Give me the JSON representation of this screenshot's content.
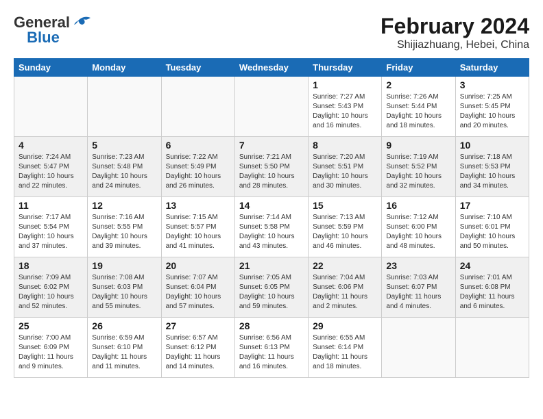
{
  "header": {
    "logo_general": "General",
    "logo_blue": "Blue",
    "month_year": "February 2024",
    "location": "Shijiazhuang, Hebei, China"
  },
  "days_of_week": [
    "Sunday",
    "Monday",
    "Tuesday",
    "Wednesday",
    "Thursday",
    "Friday",
    "Saturday"
  ],
  "weeks": [
    [
      {
        "day": "",
        "info": ""
      },
      {
        "day": "",
        "info": ""
      },
      {
        "day": "",
        "info": ""
      },
      {
        "day": "",
        "info": ""
      },
      {
        "day": "1",
        "info": "Sunrise: 7:27 AM\nSunset: 5:43 PM\nDaylight: 10 hours\nand 16 minutes."
      },
      {
        "day": "2",
        "info": "Sunrise: 7:26 AM\nSunset: 5:44 PM\nDaylight: 10 hours\nand 18 minutes."
      },
      {
        "day": "3",
        "info": "Sunrise: 7:25 AM\nSunset: 5:45 PM\nDaylight: 10 hours\nand 20 minutes."
      }
    ],
    [
      {
        "day": "4",
        "info": "Sunrise: 7:24 AM\nSunset: 5:47 PM\nDaylight: 10 hours\nand 22 minutes."
      },
      {
        "day": "5",
        "info": "Sunrise: 7:23 AM\nSunset: 5:48 PM\nDaylight: 10 hours\nand 24 minutes."
      },
      {
        "day": "6",
        "info": "Sunrise: 7:22 AM\nSunset: 5:49 PM\nDaylight: 10 hours\nand 26 minutes."
      },
      {
        "day": "7",
        "info": "Sunrise: 7:21 AM\nSunset: 5:50 PM\nDaylight: 10 hours\nand 28 minutes."
      },
      {
        "day": "8",
        "info": "Sunrise: 7:20 AM\nSunset: 5:51 PM\nDaylight: 10 hours\nand 30 minutes."
      },
      {
        "day": "9",
        "info": "Sunrise: 7:19 AM\nSunset: 5:52 PM\nDaylight: 10 hours\nand 32 minutes."
      },
      {
        "day": "10",
        "info": "Sunrise: 7:18 AM\nSunset: 5:53 PM\nDaylight: 10 hours\nand 34 minutes."
      }
    ],
    [
      {
        "day": "11",
        "info": "Sunrise: 7:17 AM\nSunset: 5:54 PM\nDaylight: 10 hours\nand 37 minutes."
      },
      {
        "day": "12",
        "info": "Sunrise: 7:16 AM\nSunset: 5:55 PM\nDaylight: 10 hours\nand 39 minutes."
      },
      {
        "day": "13",
        "info": "Sunrise: 7:15 AM\nSunset: 5:57 PM\nDaylight: 10 hours\nand 41 minutes."
      },
      {
        "day": "14",
        "info": "Sunrise: 7:14 AM\nSunset: 5:58 PM\nDaylight: 10 hours\nand 43 minutes."
      },
      {
        "day": "15",
        "info": "Sunrise: 7:13 AM\nSunset: 5:59 PM\nDaylight: 10 hours\nand 46 minutes."
      },
      {
        "day": "16",
        "info": "Sunrise: 7:12 AM\nSunset: 6:00 PM\nDaylight: 10 hours\nand 48 minutes."
      },
      {
        "day": "17",
        "info": "Sunrise: 7:10 AM\nSunset: 6:01 PM\nDaylight: 10 hours\nand 50 minutes."
      }
    ],
    [
      {
        "day": "18",
        "info": "Sunrise: 7:09 AM\nSunset: 6:02 PM\nDaylight: 10 hours\nand 52 minutes."
      },
      {
        "day": "19",
        "info": "Sunrise: 7:08 AM\nSunset: 6:03 PM\nDaylight: 10 hours\nand 55 minutes."
      },
      {
        "day": "20",
        "info": "Sunrise: 7:07 AM\nSunset: 6:04 PM\nDaylight: 10 hours\nand 57 minutes."
      },
      {
        "day": "21",
        "info": "Sunrise: 7:05 AM\nSunset: 6:05 PM\nDaylight: 10 hours\nand 59 minutes."
      },
      {
        "day": "22",
        "info": "Sunrise: 7:04 AM\nSunset: 6:06 PM\nDaylight: 11 hours\nand 2 minutes."
      },
      {
        "day": "23",
        "info": "Sunrise: 7:03 AM\nSunset: 6:07 PM\nDaylight: 11 hours\nand 4 minutes."
      },
      {
        "day": "24",
        "info": "Sunrise: 7:01 AM\nSunset: 6:08 PM\nDaylight: 11 hours\nand 6 minutes."
      }
    ],
    [
      {
        "day": "25",
        "info": "Sunrise: 7:00 AM\nSunset: 6:09 PM\nDaylight: 11 hours\nand 9 minutes."
      },
      {
        "day": "26",
        "info": "Sunrise: 6:59 AM\nSunset: 6:10 PM\nDaylight: 11 hours\nand 11 minutes."
      },
      {
        "day": "27",
        "info": "Sunrise: 6:57 AM\nSunset: 6:12 PM\nDaylight: 11 hours\nand 14 minutes."
      },
      {
        "day": "28",
        "info": "Sunrise: 6:56 AM\nSunset: 6:13 PM\nDaylight: 11 hours\nand 16 minutes."
      },
      {
        "day": "29",
        "info": "Sunrise: 6:55 AM\nSunset: 6:14 PM\nDaylight: 11 hours\nand 18 minutes."
      },
      {
        "day": "",
        "info": ""
      },
      {
        "day": "",
        "info": ""
      }
    ]
  ]
}
